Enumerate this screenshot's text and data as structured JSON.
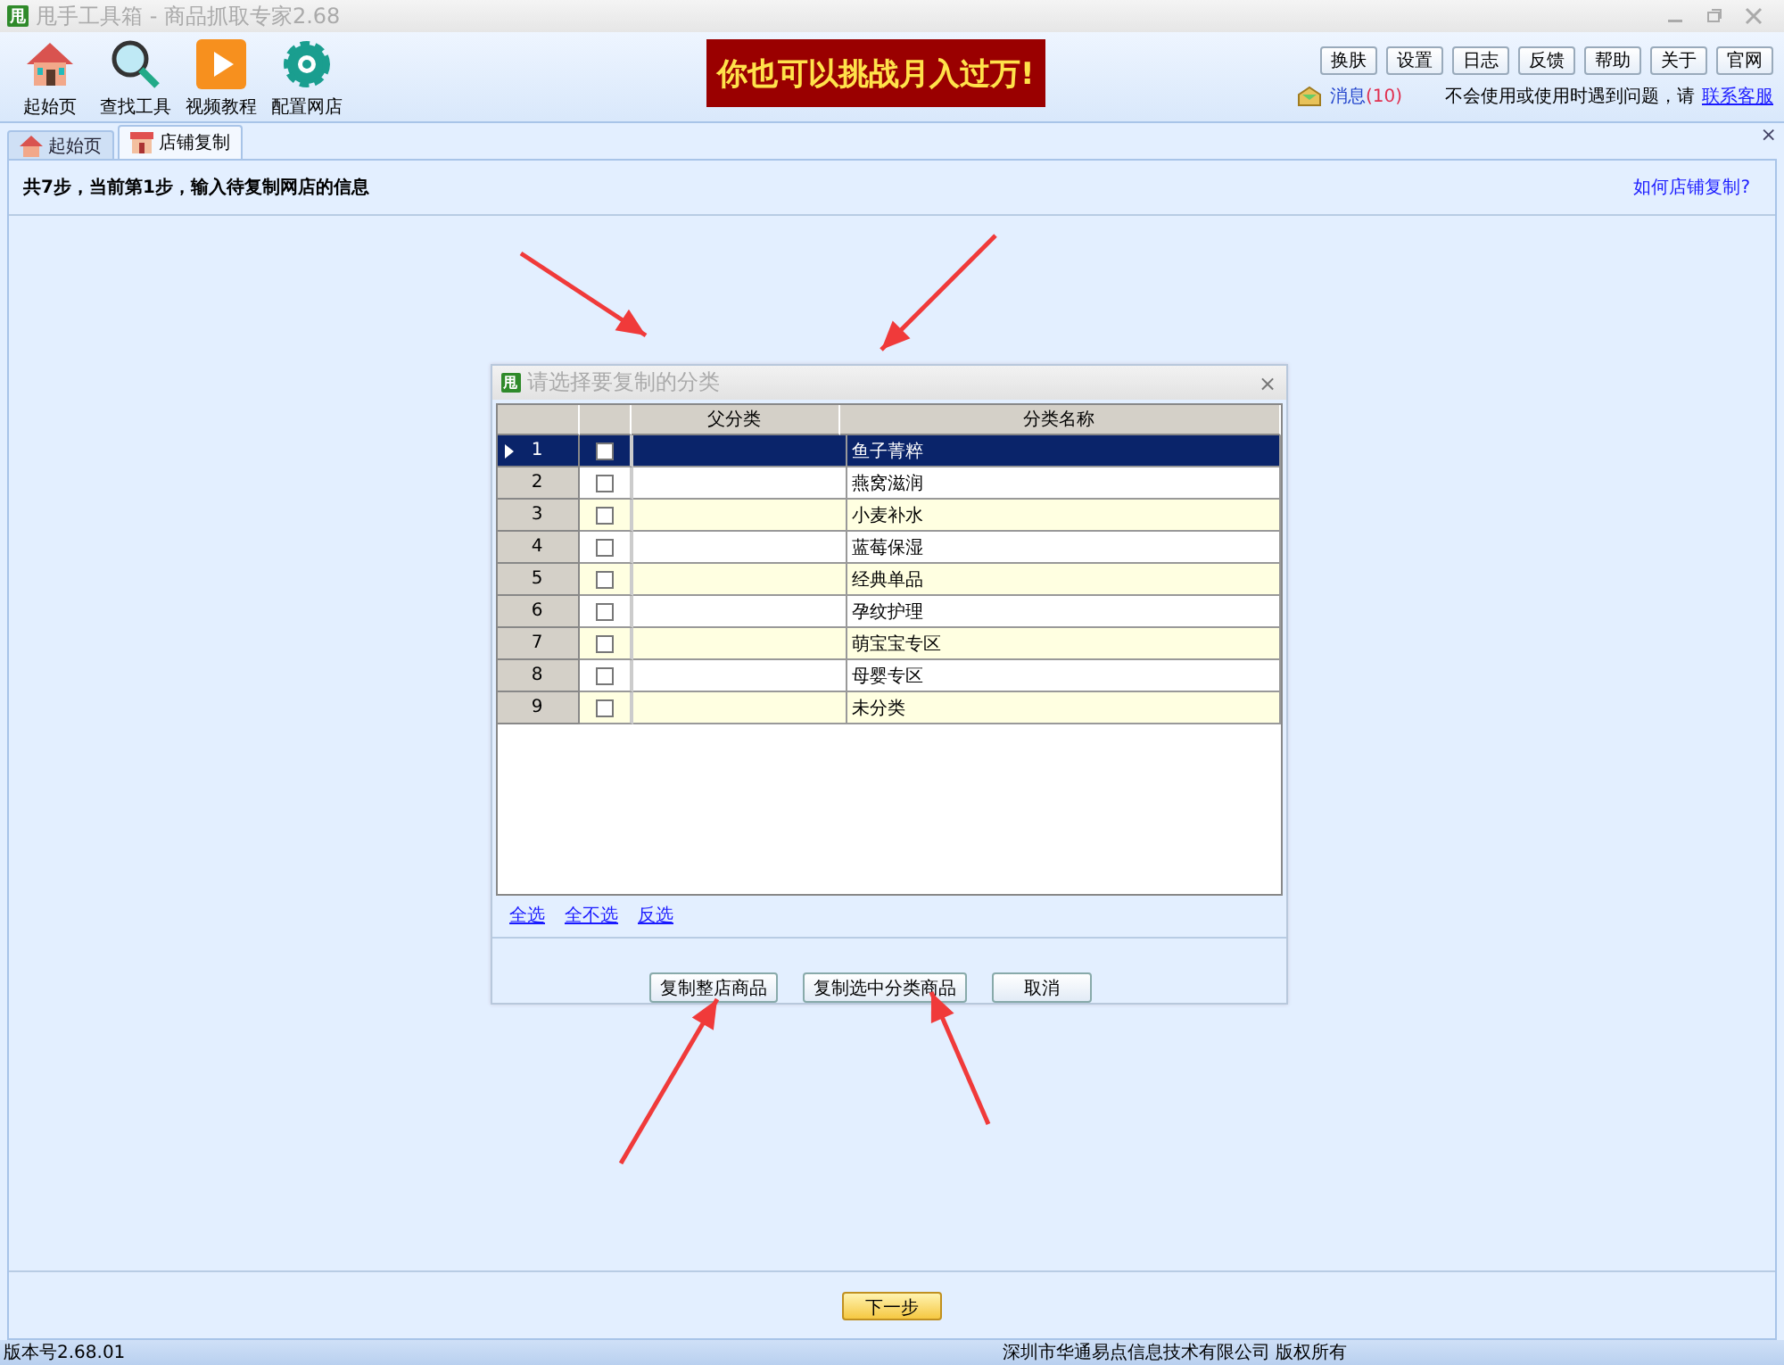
{
  "window": {
    "app_icon_text": "甩",
    "title": "甩手工具箱 - 商品抓取专家2.68"
  },
  "toolbar": [
    {
      "kind": "home",
      "label": "起始页"
    },
    {
      "kind": "search",
      "label": "查找工具"
    },
    {
      "kind": "play",
      "label": "视频教程"
    },
    {
      "kind": "gear",
      "label": "配置网店"
    }
  ],
  "banner": {
    "text": "你也可以挑战月入过万!"
  },
  "top_buttons": [
    "换肤",
    "设置",
    "日志",
    "反馈",
    "帮助",
    "关于",
    "官网"
  ],
  "messages": {
    "label": "消息",
    "count": "(10)"
  },
  "help": {
    "text": "不会使用或使用时遇到问题，请",
    "link": "联系客服"
  },
  "tabs": [
    {
      "kind": "home",
      "label": "起始页",
      "selected": false
    },
    {
      "kind": "store",
      "label": "店铺复制",
      "selected": true
    }
  ],
  "tab_close": "×",
  "step": {
    "text": "共7步，当前第1步，输入待复制网店的信息",
    "link": "如何店铺复制?"
  },
  "dialog": {
    "icon_text": "甩",
    "title": "请选择要复制的分类",
    "close": "×",
    "columns": [
      "父分类",
      "分类名称"
    ],
    "rows": [
      {
        "number": "1",
        "checked": false,
        "selected": true,
        "name": "鱼子菁粹"
      },
      {
        "number": "2",
        "checked": false,
        "selected": false,
        "name": "燕窝滋润"
      },
      {
        "number": "3",
        "checked": false,
        "selected": false,
        "name": "小麦补水"
      },
      {
        "number": "4",
        "checked": false,
        "selected": false,
        "name": "蓝莓保湿"
      },
      {
        "number": "5",
        "checked": false,
        "selected": false,
        "name": "经典单品"
      },
      {
        "number": "6",
        "checked": false,
        "selected": false,
        "name": "孕纹护理"
      },
      {
        "number": "7",
        "checked": false,
        "selected": false,
        "name": "萌宝宝专区"
      },
      {
        "number": "8",
        "checked": false,
        "selected": false,
        "name": "母婴专区"
      },
      {
        "number": "9",
        "checked": false,
        "selected": false,
        "name": "未分类"
      }
    ],
    "links": [
      "全选",
      "全不选",
      "反选"
    ],
    "buttons": [
      "复制整店商品",
      "复制选中分类商品",
      "取消"
    ]
  },
  "next_button": "下一步",
  "status_bar": {
    "version": "版本号2.68.01",
    "copyright": "深圳市华通易点信息技术有限公司 版权所有"
  }
}
